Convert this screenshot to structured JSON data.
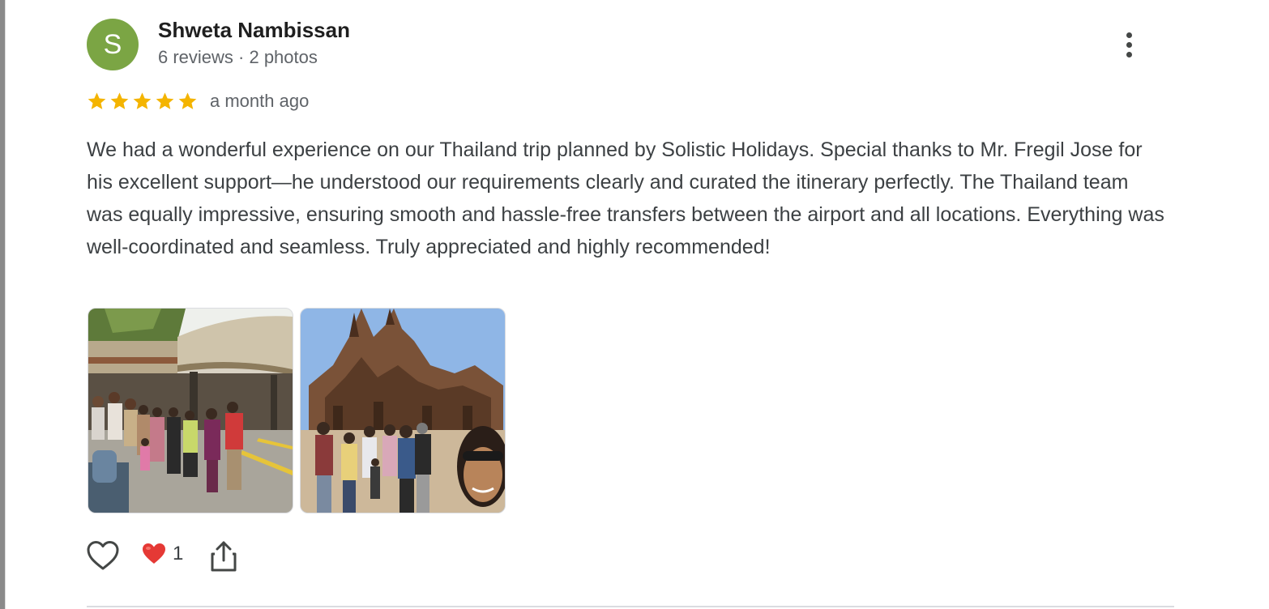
{
  "reviewer": {
    "initial": "S",
    "name": "Shweta Nambissan",
    "meta": "6 reviews · 2 photos",
    "avatar_color": "#7ba544"
  },
  "rating": {
    "stars": 5,
    "max_stars": 5,
    "star_color": "#f4b400",
    "date": "a month ago"
  },
  "review": {
    "text": "We had a wonderful experience on our Thailand trip planned by Solistic Holidays. Special thanks to Mr. Fregil Jose for his excellent support—he understood our requirements clearly and curated the itinerary perfectly. The Thailand team was equally impressive, ensuring smooth and hassle-free transfers between the airport and all locations. Everything was well-coordinated and seamless. Truly appreciated and highly recommended!"
  },
  "photos": [
    {
      "icon": "group-photo-hotel-entrance"
    },
    {
      "icon": "group-photo-sanctuary-of-truth"
    }
  ],
  "actions": {
    "like_icon": "heart-outline-icon",
    "reaction_icon": "red-heart-emoji",
    "reaction_count": "1",
    "share_icon": "share-icon"
  }
}
